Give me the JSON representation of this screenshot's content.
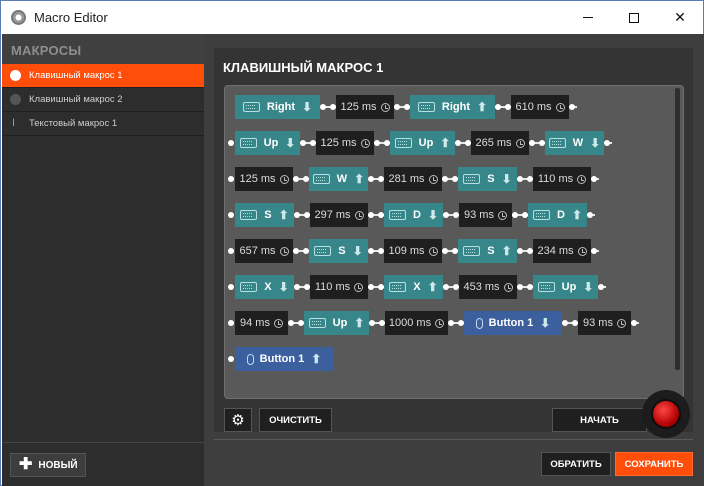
{
  "window": {
    "title": "Macro Editor"
  },
  "sidebar": {
    "header": "МАКРОСЫ",
    "items": [
      {
        "label": "Клавишный макрос 1",
        "type": "key",
        "active": true
      },
      {
        "label": "Клавишный макрос 2",
        "type": "key",
        "active": false
      },
      {
        "label": "Текстовый макрос 1",
        "type": "text",
        "active": false
      }
    ],
    "new_button": "НОВЫЙ"
  },
  "editor": {
    "title": "КЛАВИШНЫЙ МАКРОС 1",
    "clear_label": "ОЧИСТИТЬ",
    "start_label": "НАЧАТЬ",
    "revert_label": "ОБРАТИТЬ",
    "save_label": "СОХРАНИТЬ",
    "sequence": [
      [
        {
          "t": "key",
          "label": "Right",
          "dir": "down"
        },
        {
          "t": "delay",
          "label": "125 ms"
        },
        {
          "t": "key",
          "label": "Right",
          "dir": "up"
        },
        {
          "t": "delay",
          "label": "610 ms"
        }
      ],
      [
        {
          "t": "key",
          "label": "Up",
          "dir": "down"
        },
        {
          "t": "delay",
          "label": "125 ms"
        },
        {
          "t": "key",
          "label": "Up",
          "dir": "up"
        },
        {
          "t": "delay",
          "label": "265 ms"
        },
        {
          "t": "key",
          "label": "W",
          "dir": "down"
        }
      ],
      [
        {
          "t": "delay",
          "label": "125 ms"
        },
        {
          "t": "key",
          "label": "W",
          "dir": "up"
        },
        {
          "t": "delay",
          "label": "281 ms"
        },
        {
          "t": "key",
          "label": "S",
          "dir": "down"
        },
        {
          "t": "delay",
          "label": "110 ms"
        }
      ],
      [
        {
          "t": "key",
          "label": "S",
          "dir": "up"
        },
        {
          "t": "delay",
          "label": "297 ms"
        },
        {
          "t": "key",
          "label": "D",
          "dir": "down"
        },
        {
          "t": "delay",
          "label": "93 ms"
        },
        {
          "t": "key",
          "label": "D",
          "dir": "up"
        }
      ],
      [
        {
          "t": "delay",
          "label": "657 ms"
        },
        {
          "t": "key",
          "label": "S",
          "dir": "down"
        },
        {
          "t": "delay",
          "label": "109 ms"
        },
        {
          "t": "key",
          "label": "S",
          "dir": "up"
        },
        {
          "t": "delay",
          "label": "234 ms"
        }
      ],
      [
        {
          "t": "key",
          "label": "X",
          "dir": "down"
        },
        {
          "t": "delay",
          "label": "110 ms"
        },
        {
          "t": "key",
          "label": "X",
          "dir": "up"
        },
        {
          "t": "delay",
          "label": "453 ms"
        },
        {
          "t": "key",
          "label": "Up",
          "dir": "down"
        }
      ],
      [
        {
          "t": "delay",
          "label": "94 ms"
        },
        {
          "t": "key",
          "label": "Up",
          "dir": "up"
        },
        {
          "t": "delay",
          "label": "1000 ms"
        },
        {
          "t": "mouse",
          "label": "Button 1",
          "dir": "down"
        },
        {
          "t": "delay",
          "label": "93 ms"
        }
      ],
      [
        {
          "t": "mouse",
          "label": "Button 1",
          "dir": "up"
        }
      ]
    ]
  },
  "colors": {
    "accent": "#ff4d0a",
    "key_block": "#37868a",
    "mouse_block": "#3c5f9e",
    "delay_block": "#1f1f1f"
  }
}
